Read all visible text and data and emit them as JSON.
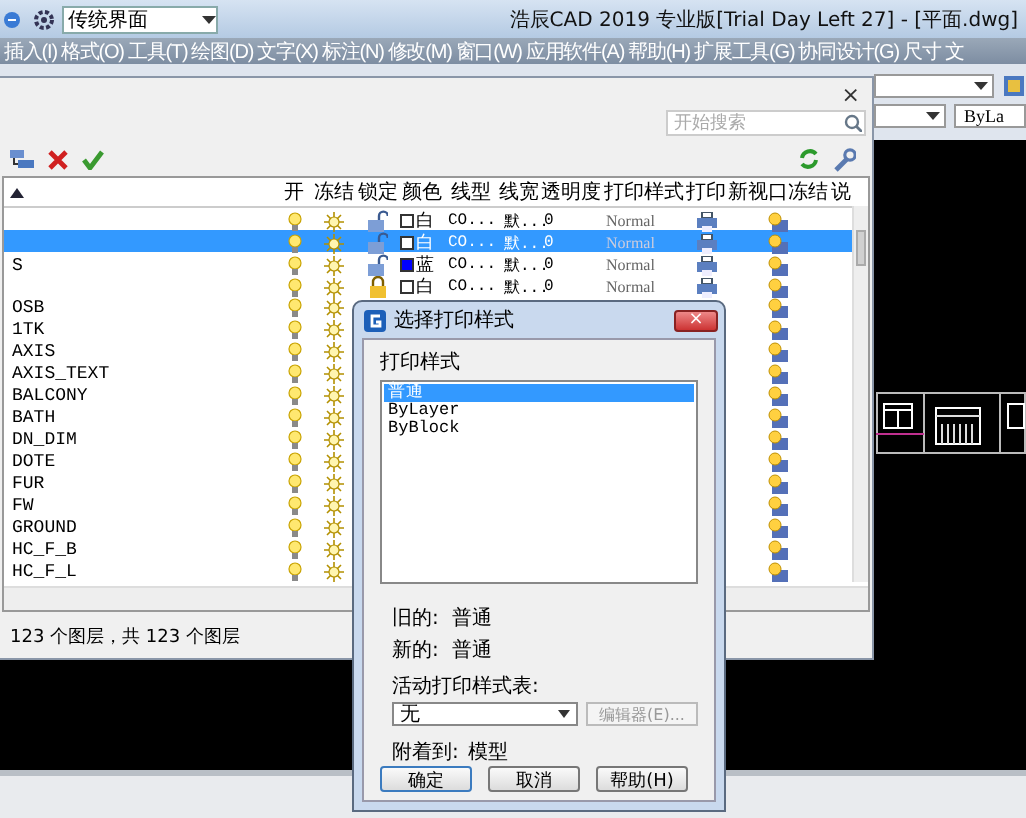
{
  "app": {
    "workspace": "传统界面",
    "title": "浩辰CAD 2019 专业版[Trial Day Left 27] - [平面.dwg]",
    "menu": [
      "插入(I)",
      "格式(O)",
      "工具(T)",
      "绘图(D)",
      "文字(X)",
      "标注(N)",
      "修改(M)",
      "窗口(W)",
      "应用软件(A)",
      "帮助(H)",
      "扩展工具(G)",
      "协同设计(G)",
      "尺寸",
      "文"
    ],
    "linetype_combo": "ByLa"
  },
  "layer_manager": {
    "close": "×",
    "search": {
      "placeholder": "开始搜索"
    },
    "columns": [
      "开",
      "冻结",
      "锁定",
      "颜色",
      "线型",
      "线宽",
      "透明度",
      "打印样式",
      "打印",
      "新视口冻结",
      "说"
    ],
    "rows": [
      {
        "name": "",
        "selected": false,
        "on": true,
        "frozen": false,
        "locked": false,
        "color_name": "白",
        "color": "#ffffff",
        "linetype": "CO...",
        "lineweight": "默...",
        "transparency": "0",
        "plot_style": "Normal"
      },
      {
        "name": "",
        "selected": true,
        "on": true,
        "frozen": false,
        "locked": false,
        "color_name": "白",
        "color": "#ffffff",
        "linetype": "CO...",
        "lineweight": "默...",
        "transparency": "0",
        "plot_style": "Normal"
      },
      {
        "name": "S",
        "selected": false,
        "on": true,
        "frozen": false,
        "locked": false,
        "color_name": "蓝",
        "color": "#0000ff",
        "linetype": "CO...",
        "lineweight": "默...",
        "transparency": "0",
        "plot_style": "Normal"
      },
      {
        "name": "",
        "selected": false,
        "on": true,
        "frozen": false,
        "locked": true,
        "color_name": "白",
        "color": "#ffffff",
        "linetype": "CO...",
        "lineweight": "默...",
        "transparency": "0",
        "plot_style": "Normal"
      },
      {
        "name": "OSB",
        "selected": false,
        "on": true,
        "frozen": false
      },
      {
        "name": "1TK",
        "selected": false,
        "on": true,
        "frozen": false
      },
      {
        "name": "AXIS",
        "selected": false,
        "on": true,
        "frozen": false
      },
      {
        "name": "AXIS_TEXT",
        "selected": false,
        "on": true,
        "frozen": false
      },
      {
        "name": "BALCONY",
        "selected": false,
        "on": true,
        "frozen": false
      },
      {
        "name": "BATH",
        "selected": false,
        "on": true,
        "frozen": false
      },
      {
        "name": "DN_DIM",
        "selected": false,
        "on": true,
        "frozen": false
      },
      {
        "name": "DOTE",
        "selected": false,
        "on": true,
        "frozen": false
      },
      {
        "name": "FUR",
        "selected": false,
        "on": true,
        "frozen": false
      },
      {
        "name": "FW",
        "selected": false,
        "on": true,
        "frozen": false
      },
      {
        "name": "GROUND",
        "selected": false,
        "on": true,
        "frozen": false
      },
      {
        "name": "HC_F_B",
        "selected": false,
        "on": true,
        "frozen": false
      },
      {
        "name": "HC_F_L",
        "selected": false,
        "on": true,
        "frozen": false
      }
    ],
    "status": "123 个图层，共 123 个图层"
  },
  "dialog": {
    "title": "选择打印样式",
    "close": "×",
    "list_label": "打印样式",
    "styles": [
      {
        "label": "普通",
        "selected": true
      },
      {
        "label": "ByLayer",
        "selected": false
      },
      {
        "label": "ByBlock",
        "selected": false
      }
    ],
    "old_label": "旧的:",
    "old_value": "普通",
    "new_label": "新的:",
    "new_value": "普通",
    "table_label": "活动打印样式表:",
    "table_value": "无",
    "editor_button": {
      "label": "编辑器(E)...",
      "disabled": true
    },
    "attached_label": "附着到:",
    "attached_value": "模型",
    "buttons": [
      "确定",
      "取消",
      "帮助(H)"
    ]
  }
}
